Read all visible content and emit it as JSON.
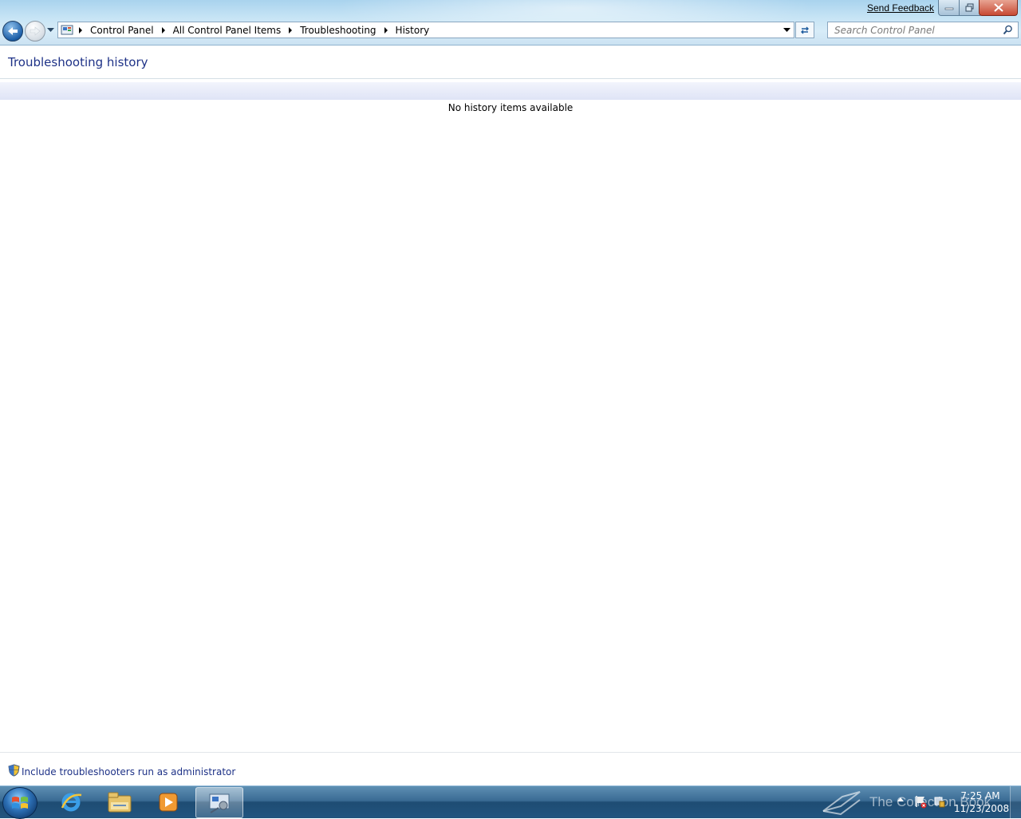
{
  "window": {
    "send_feedback": "Send Feedback"
  },
  "address": {
    "breadcrumbs": [
      "Control Panel",
      "All Control Panel Items",
      "Troubleshooting",
      "History"
    ]
  },
  "search": {
    "placeholder": "Search Control Panel"
  },
  "main": {
    "title": "Troubleshooting history",
    "empty_message": "No history items available",
    "admin_link": "Include troubleshooters run as administrator"
  },
  "taskbar": {
    "pinned": [
      "internet-explorer-icon",
      "windows-explorer-icon",
      "media-player-icon",
      "control-panel-icon"
    ],
    "active_item": "control-panel-icon",
    "watermark": "The Collection Book",
    "clock_time": "7:25 AM",
    "clock_date": "11/23/2008"
  },
  "colors": {
    "link": "#1e3287",
    "chrome": "#c7e4f5",
    "taskbar": "#22557f"
  }
}
